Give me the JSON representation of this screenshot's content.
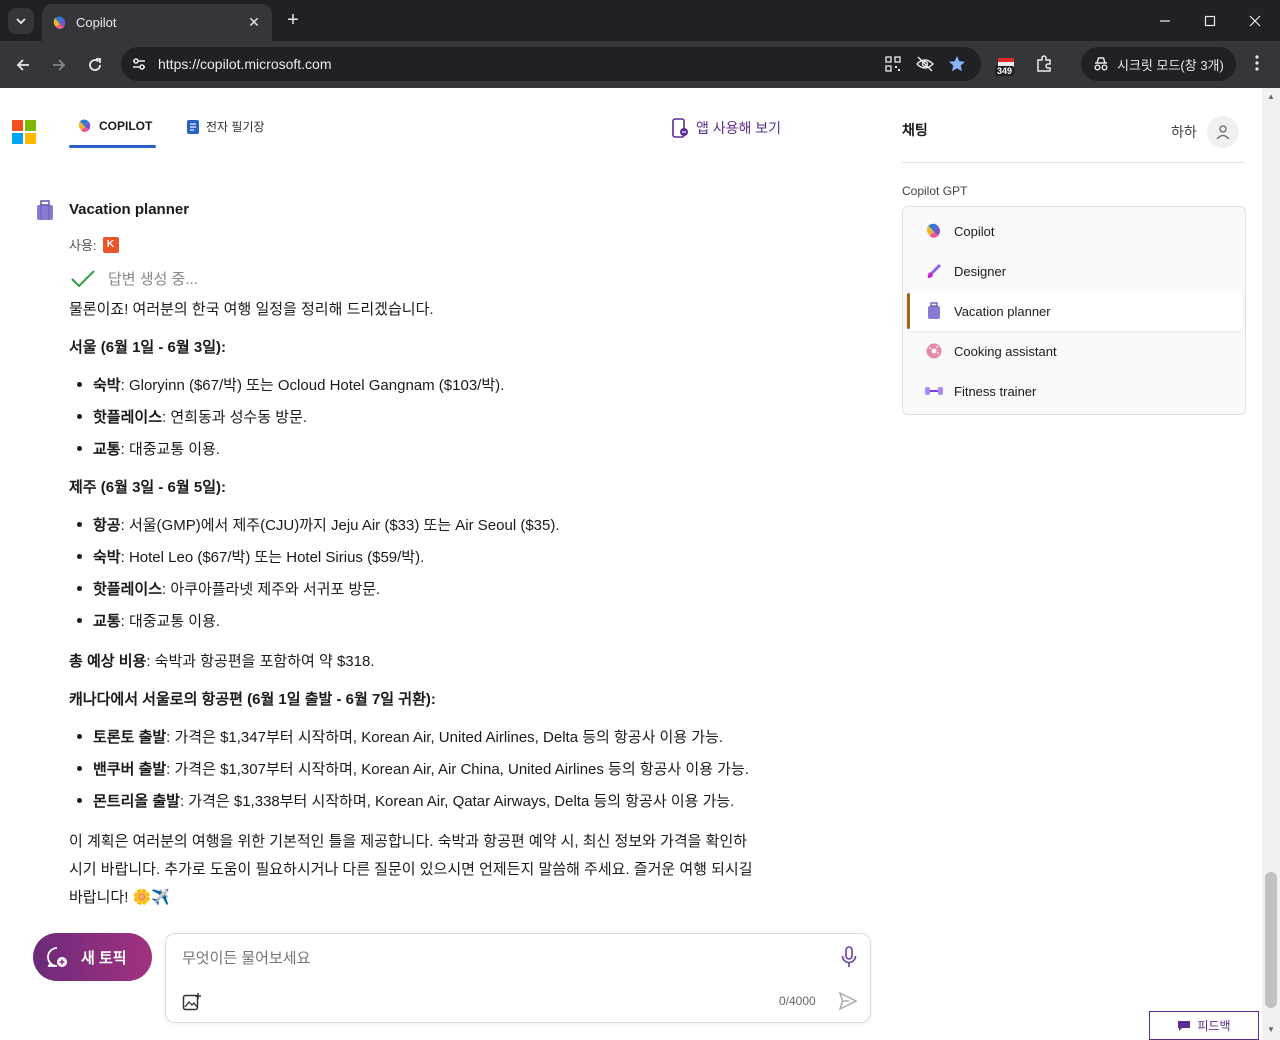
{
  "browser": {
    "tab_title": "Copilot",
    "url": "https://copilot.microsoft.com",
    "extension_badge": "349",
    "incognito_label": "시크릿 모드(창 3개)"
  },
  "header": {
    "tabs": [
      {
        "label": "COPILOT"
      },
      {
        "label": "전자 필기장"
      }
    ],
    "try_app_label": "앱 사용해 보기"
  },
  "sidebar": {
    "title": "채팅",
    "user_name": "하하",
    "gpt_section_label": "Copilot GPT",
    "gpts": [
      {
        "label": "Copilot"
      },
      {
        "label": "Designer"
      },
      {
        "label": "Vacation planner"
      },
      {
        "label": "Cooking assistant"
      },
      {
        "label": "Fitness trainer"
      }
    ]
  },
  "chat": {
    "bot_name": "Vacation planner",
    "using_label": "사용:",
    "using_badge": "K",
    "status": "답변 생성 중...",
    "intro": "물론이죠! 여러분의 한국 여행 일정을 정리해 드리겠습니다.",
    "seoul": {
      "heading": "서울 (6월 1일 - 6월 3일):",
      "items": [
        {
          "label": "숙박",
          "text": ": Gloryinn ($67/박) 또는 Ocloud Hotel Gangnam ($103/박)."
        },
        {
          "label": "핫플레이스",
          "text": ": 연희동과 성수동 방문."
        },
        {
          "label": "교통",
          "text": ": 대중교통 이용."
        }
      ]
    },
    "jeju": {
      "heading": "제주 (6월 3일 - 6월 5일):",
      "items": [
        {
          "label": "항공",
          "text": ": 서울(GMP)에서 제주(CJU)까지 Jeju Air ($33) 또는 Air Seoul ($35)."
        },
        {
          "label": "숙박",
          "text": ": Hotel Leo ($67/박) 또는 Hotel Sirius ($59/박)."
        },
        {
          "label": "핫플레이스",
          "text": ": 아쿠아플라넷 제주와 서귀포 방문."
        },
        {
          "label": "교통",
          "text": ": 대중교통 이용."
        }
      ]
    },
    "total": {
      "label": "총 예상 비용",
      "text": ": 숙박과 항공편을 포함하여 약 $318."
    },
    "flights": {
      "heading": "캐나다에서 서울로의 항공편 (6월 1일 출발 - 6월 7일 귀환):",
      "items": [
        {
          "label": "토론토 출발",
          "text": ": 가격은 $1,347부터 시작하며, Korean Air, United Airlines, Delta 등의 항공사 이용 가능."
        },
        {
          "label": "밴쿠버 출발",
          "text": ": 가격은 $1,307부터 시작하며, Korean Air, Air China, United Airlines 등의 항공사 이용 가능."
        },
        {
          "label": "몬트리올 출발",
          "text": ": 가격은 $1,338부터 시작하며, Korean Air, Qatar Airways, Delta 등의 항공사 이용 가능."
        }
      ]
    },
    "closing": [
      "이 계획은 여러분의 여행을 위한 기본적인 틀을 제공합니다. 숙박과 항공편 예약 시, 최신 정보와 가격을 확인하",
      "시기 바랍니다. 추가로 도움이 필요하시거나 다른 질문이 있으시면 언제든지 말씀해 주세요. 즐거운 여행 되시길",
      "바랍니다! 🌼✈️"
    ]
  },
  "composer": {
    "new_topic_label": "새 토픽",
    "placeholder": "무엇이든 물어보세요",
    "counter": "0/4000"
  },
  "feedback_label": "피드백",
  "colors": {
    "accent": "#2862c7",
    "brand_purple": "#5c2d91",
    "selected_marker": "#a56316"
  }
}
